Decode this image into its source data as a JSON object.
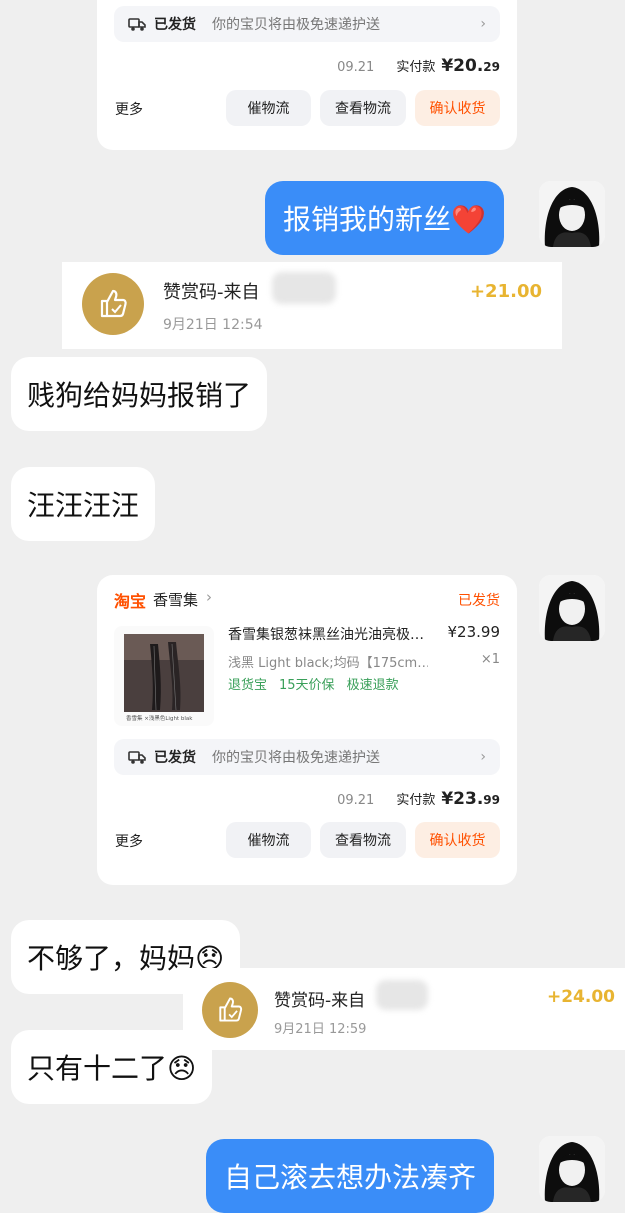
{
  "order1": {
    "ship_status": "已发货",
    "ship_desc": "你的宝贝将由极免速递护送",
    "date": "09.21",
    "paid_label": "实付款",
    "price_main": "¥20.",
    "price_cents": "29",
    "more": "更多",
    "btn_urge": "催物流",
    "btn_view": "查看物流",
    "btn_confirm": "确认收货"
  },
  "msg_reimburse": "报销我的新丝❤️",
  "tip1": {
    "title": "赞赏码-来自",
    "time": "9月21日 12:54",
    "amount": "+21.00"
  },
  "msg_dog": "贱狗给妈妈报销了",
  "msg_woof": "汪汪汪汪",
  "order2": {
    "platform": "淘宝",
    "shop": "香雪集",
    "status": "已发货",
    "product_title": "香雪集银葱袜黑丝油光油亮极…",
    "product_price": "¥23.99",
    "variant": "浅黑 Light black;均码【175cm…",
    "qty": "×1",
    "tags": [
      "退货宝",
      "15天价保",
      "极速退款"
    ],
    "thumb_caption": "香雪集 ×浅黑色Light blak",
    "ship_status": "已发货",
    "ship_desc": "你的宝贝将由极免速递护送",
    "date": "09.21",
    "paid_label": "实付款",
    "price_main": "¥23.",
    "price_cents": "99",
    "more": "更多",
    "btn_urge": "催物流",
    "btn_view": "查看物流",
    "btn_confirm": "确认收货"
  },
  "msg_not_enough": "不够了，妈妈😞",
  "tip2": {
    "title": "赞赏码-来自",
    "time": "9月21日 12:59",
    "amount": "+24.00"
  },
  "msg_twelve": "只有十二了😞",
  "msg_figure": "自己滚去想办法凑齐",
  "colors": {
    "accent_blue": "#3a8df8",
    "taobao_orange": "#ff5000",
    "tip_gold": "#e8b431"
  }
}
